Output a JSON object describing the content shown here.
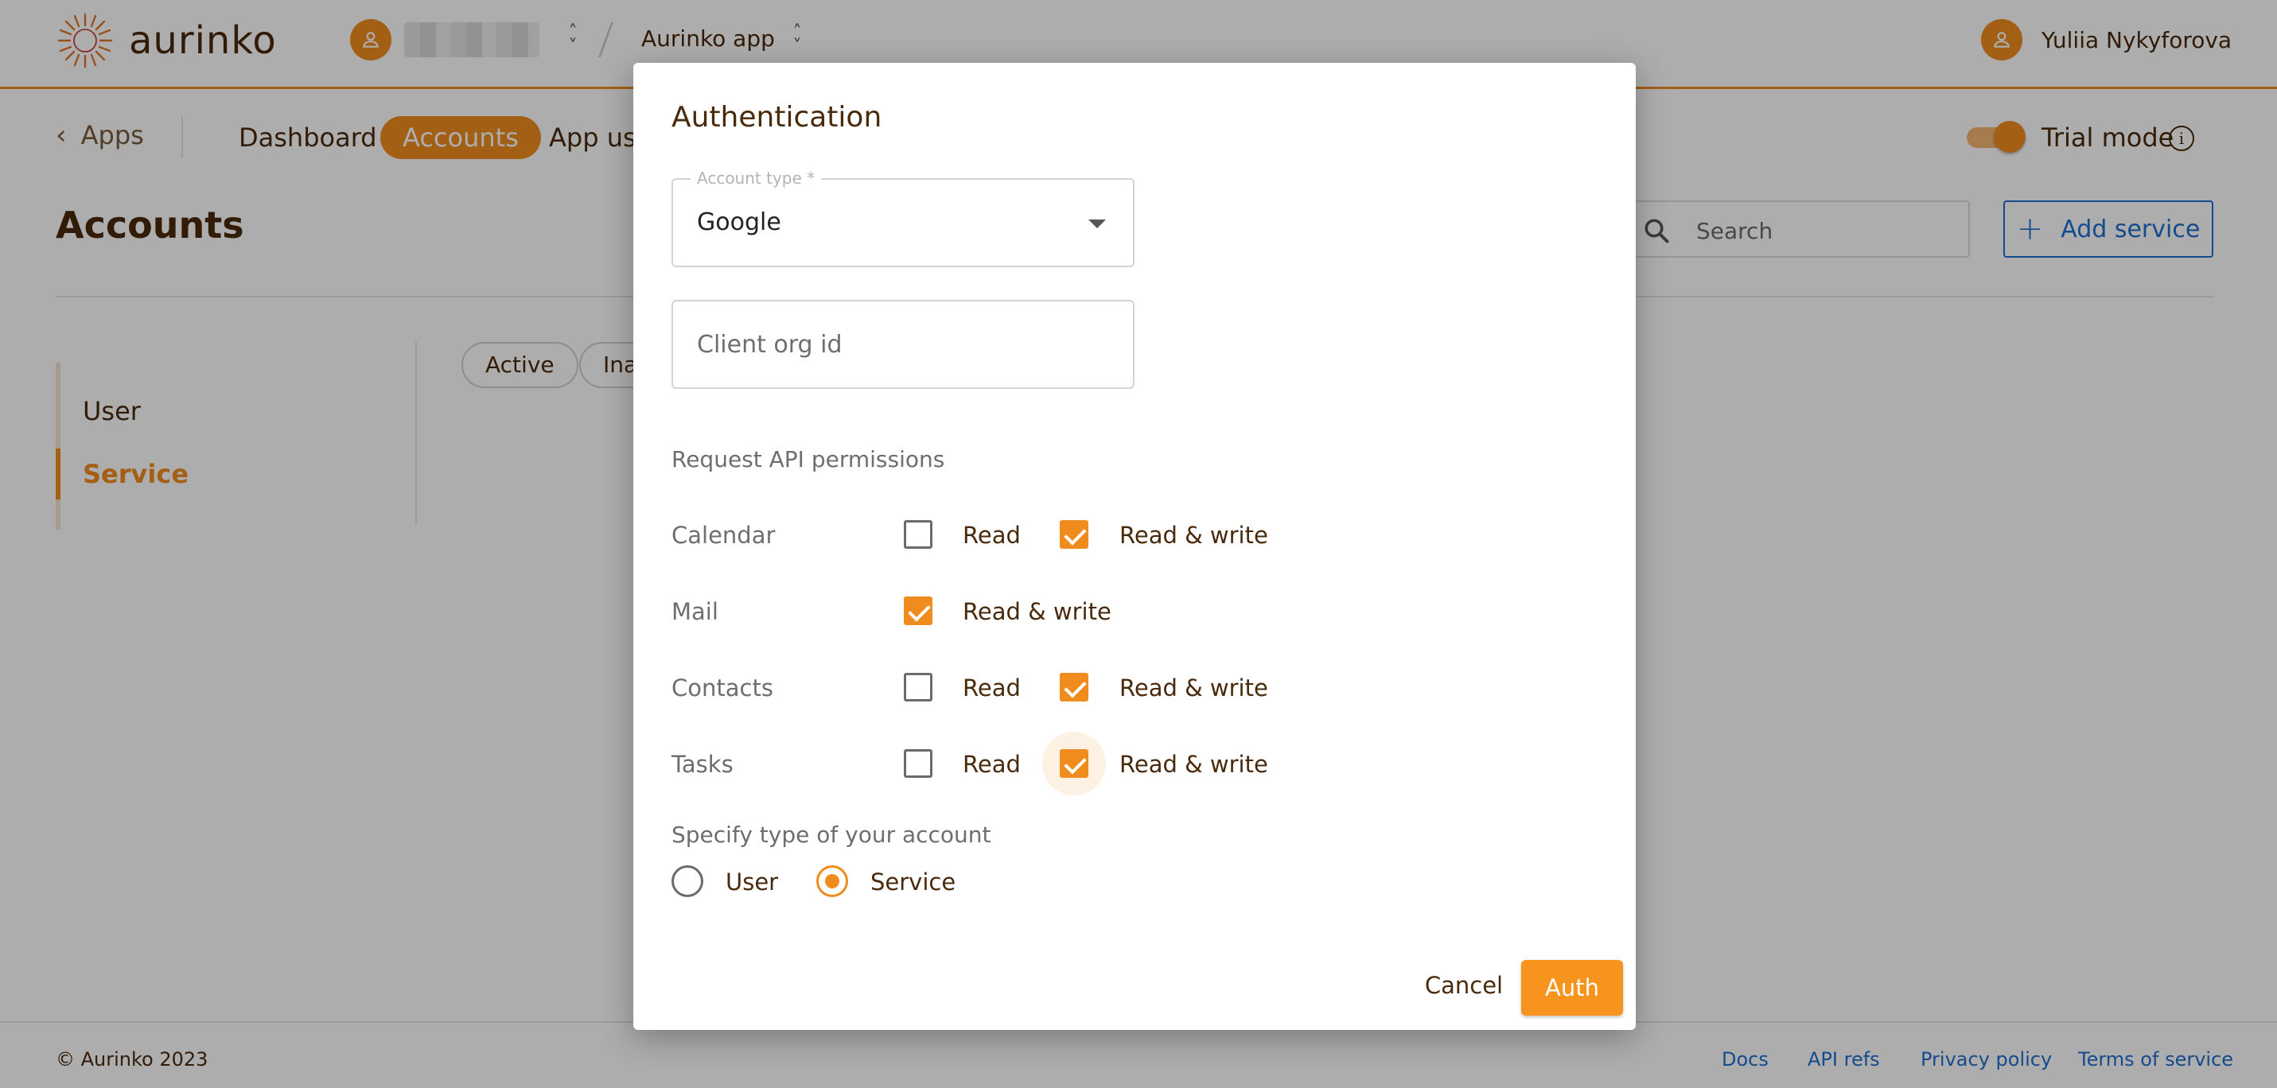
{
  "brand": {
    "name": "aurinko",
    "accent_color": "#f08c1e",
    "link_color": "#1f6fd0"
  },
  "header": {
    "org_avatar_icon": "person-icon",
    "org_switcher_icon": "unfold-icon",
    "app_name": "Aurinko app",
    "app_switcher_icon": "unfold-icon",
    "user_avatar_icon": "person-icon",
    "user_name": "Yuliia Nykyforova"
  },
  "subnav": {
    "back_label": "Apps",
    "tabs": [
      {
        "label": "Dashboard",
        "active": false
      },
      {
        "label": "Accounts",
        "active": true
      },
      {
        "label": "App use",
        "active": false
      }
    ],
    "trial_mode": {
      "label": "Trial mode",
      "on": true,
      "info_icon": "info-icon"
    }
  },
  "page": {
    "title": "Accounts",
    "search_placeholder": "Search",
    "add_service_label": "Add service"
  },
  "sidebar": {
    "items": [
      {
        "label": "User",
        "active": false
      },
      {
        "label": "Service",
        "active": true
      }
    ]
  },
  "filters": [
    "Active",
    "Ina"
  ],
  "footer": {
    "copyright": "© Aurinko 2023",
    "links": [
      "Docs",
      "API refs",
      "Privacy policy",
      "Terms of service"
    ]
  },
  "modal": {
    "title": "Authentication",
    "account_type": {
      "label": "Account type *",
      "value": "Google"
    },
    "client_org_placeholder": "Client org id",
    "permissions_heading": "Request API permissions",
    "permissions": [
      {
        "name": "Calendar",
        "options": [
          {
            "label": "Read",
            "checked": false
          },
          {
            "label": "Read & write",
            "checked": true
          }
        ]
      },
      {
        "name": "Mail",
        "options": [
          {
            "label": "Read & write",
            "checked": true
          }
        ]
      },
      {
        "name": "Contacts",
        "options": [
          {
            "label": "Read",
            "checked": false
          },
          {
            "label": "Read & write",
            "checked": true
          }
        ]
      },
      {
        "name": "Tasks",
        "options": [
          {
            "label": "Read",
            "checked": false
          },
          {
            "label": "Read & write",
            "checked": true
          }
        ]
      }
    ],
    "account_kind_label": "Specify type of your account",
    "account_kinds": [
      {
        "label": "User",
        "selected": false
      },
      {
        "label": "Service",
        "selected": true
      }
    ],
    "cancel_label": "Cancel",
    "auth_label": "Auth"
  }
}
